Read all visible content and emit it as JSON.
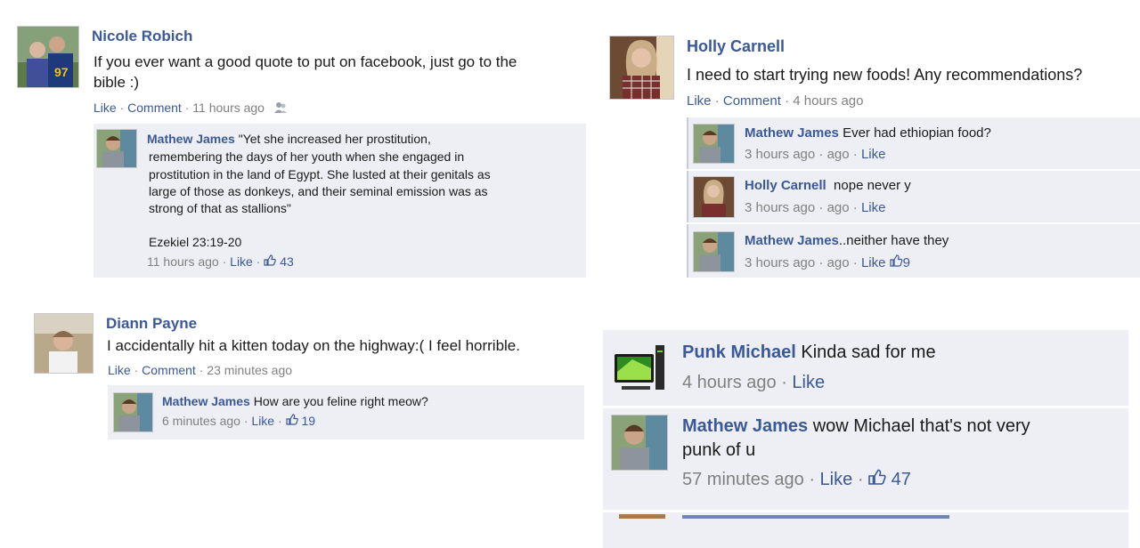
{
  "post1": {
    "author": "Nicole Robich",
    "text_line1": "If you ever want a good quote to put on facebook, just go to the",
    "text_line2": "bible :)",
    "like": "Like",
    "comment": "Comment",
    "time": "11 hours ago",
    "reply": {
      "author": "Mathew James",
      "lines": [
        "\"Yet she increased her prostitution,",
        "remembering the days of her youth when she engaged in",
        "prostitution in the land of Egypt. She lusted at their genitals as",
        "large of those as donkeys, and their seminal emission was as",
        "strong of that as stallions\""
      ],
      "citation": "Ezekiel 23:19-20",
      "time": "11 hours ago",
      "like": "Like",
      "likes_count": "43"
    }
  },
  "post2": {
    "author": "Holly Carnell",
    "text": "I need to start trying new foods! Any recommendations?",
    "like": "Like",
    "comment": "Comment",
    "time": "4 hours ago",
    "replies": [
      {
        "author": "Mathew James",
        "text": "Ever had ethiopian food?",
        "time": "3 hours ago",
        "ago": "ago",
        "like": "Like"
      },
      {
        "author": "Holly Carnell",
        "text": "nope never y",
        "time": "3 hours ago",
        "ago": "ago",
        "like": "Like"
      },
      {
        "author": "Mathew James",
        "text": "..neither have they",
        "time": "3 hours ago",
        "ago": "ago",
        "like": "Like",
        "likes_count": "9"
      }
    ]
  },
  "post3": {
    "author": "Diann Payne",
    "text": "I accidentally hit a kitten today on the highway:( I feel horrible.",
    "like": "Like",
    "comment": "Comment",
    "time": "23 minutes ago",
    "reply": {
      "author": "Mathew James",
      "text": "How are you feline right meow?",
      "time": "6 minutes ago",
      "like": "Like",
      "likes_count": "19"
    }
  },
  "post4": {
    "replies": [
      {
        "author": "Punk Michael",
        "text": "Kinda sad for me",
        "time": "4 hours ago",
        "like": "Like"
      },
      {
        "author": "Mathew James",
        "text_line1": "wow Michael that's not very",
        "text_line2": "punk of u",
        "time": "57 minutes ago",
        "like": "Like",
        "likes_count": "47"
      }
    ]
  },
  "icons": [
    "friends-icon",
    "thumbs-up-icon",
    "monitor-icon"
  ],
  "colors": {
    "link": "#3b5998",
    "comment_bg": "#edeff4",
    "meta": "#808080"
  }
}
